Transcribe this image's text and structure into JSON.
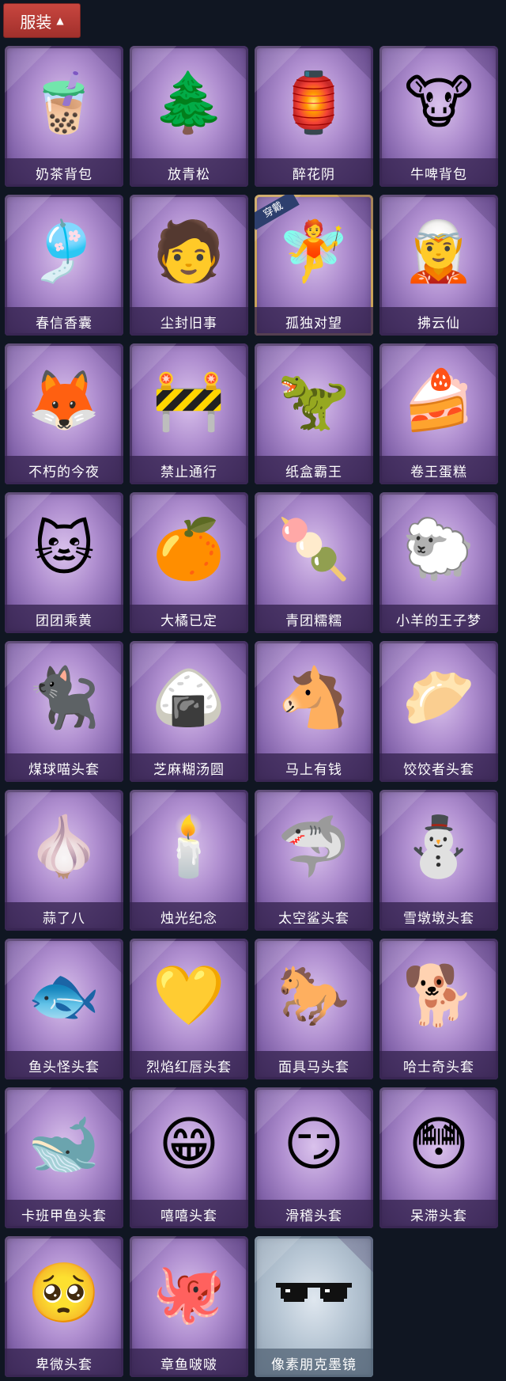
{
  "header": {
    "title": "服装"
  },
  "items": [
    {
      "name": "奶茶背包",
      "art": "🧋",
      "style": "normal"
    },
    {
      "name": "放青松",
      "art": "🌲",
      "style": "normal"
    },
    {
      "name": "醉花阴",
      "art": "🏮",
      "style": "normal"
    },
    {
      "name": "牛啤背包",
      "art": "🐮",
      "style": "normal"
    },
    {
      "name": "春信香囊",
      "art": "🎐",
      "style": "normal"
    },
    {
      "name": "尘封旧事",
      "art": "🧑",
      "style": "normal"
    },
    {
      "name": "孤独对望",
      "art": "🧚",
      "style": "selected",
      "badge": "穿戴"
    },
    {
      "name": "拂云仙",
      "art": "🧝",
      "style": "normal"
    },
    {
      "name": "不朽的今夜",
      "art": "🦊",
      "style": "normal"
    },
    {
      "name": "禁止通行",
      "art": "🚧",
      "style": "normal"
    },
    {
      "name": "纸盒霸王",
      "art": "🦖",
      "style": "normal"
    },
    {
      "name": "卷王蛋糕",
      "art": "🍰",
      "style": "normal"
    },
    {
      "name": "团团乘黄",
      "art": "🐱",
      "style": "normal"
    },
    {
      "name": "大橘已定",
      "art": "🍊",
      "style": "normal"
    },
    {
      "name": "青团糯糯",
      "art": "🍡",
      "style": "normal"
    },
    {
      "name": "小羊的王子梦",
      "art": "🐑",
      "style": "normal"
    },
    {
      "name": "煤球喵头套",
      "art": "🐈‍⬛",
      "style": "normal"
    },
    {
      "name": "芝麻糊汤圆",
      "art": "🍙",
      "style": "normal"
    },
    {
      "name": "马上有钱",
      "art": "🐴",
      "style": "normal"
    },
    {
      "name": "饺饺者头套",
      "art": "🥟",
      "style": "normal"
    },
    {
      "name": "蒜了八",
      "art": "🧄",
      "style": "normal"
    },
    {
      "name": "烛光纪念",
      "art": "🕯️",
      "style": "normal"
    },
    {
      "name": "太空鲨头套",
      "art": "🦈",
      "style": "normal"
    },
    {
      "name": "雪墩墩头套",
      "art": "⛄",
      "style": "normal"
    },
    {
      "name": "鱼头怪头套",
      "art": "🐟",
      "style": "normal"
    },
    {
      "name": "烈焰红唇头套",
      "art": "💛",
      "style": "normal"
    },
    {
      "name": "面具马头套",
      "art": "🐎",
      "style": "normal"
    },
    {
      "name": "哈士奇头套",
      "art": "🐕",
      "style": "normal"
    },
    {
      "name": "卡班甲鱼头套",
      "art": "🐋",
      "style": "normal"
    },
    {
      "name": "嘻嘻头套",
      "art": "😁",
      "style": "normal"
    },
    {
      "name": "滑稽头套",
      "art": "😏",
      "style": "normal"
    },
    {
      "name": "呆滞头套",
      "art": "😳",
      "style": "normal"
    },
    {
      "name": "卑微头套",
      "art": "🥺",
      "style": "normal"
    },
    {
      "name": "章鱼啵啵",
      "art": "🐙",
      "style": "normal"
    },
    {
      "name": "像素朋克墨镜",
      "art": "sunglasses",
      "style": "grey"
    }
  ]
}
